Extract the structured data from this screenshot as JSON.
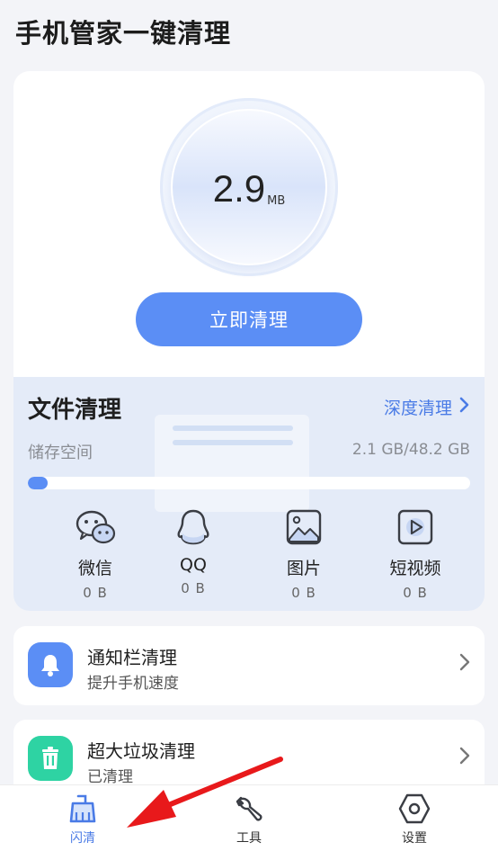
{
  "app": {
    "title": "手机管家一键清理"
  },
  "hero": {
    "size_value": "2.9",
    "size_unit": "MB",
    "clean_button": "立即清理"
  },
  "file_clean": {
    "title": "文件清理",
    "deep_clean": "深度清理",
    "storage_label": "储存空间",
    "storage_value": "2.1 GB/48.2 GB",
    "storage_fraction": 0.044,
    "categories": [
      {
        "name": "微信",
        "value": "0 B",
        "icon": "wechat-icon"
      },
      {
        "name": "QQ",
        "value": "0 B",
        "icon": "qq-icon"
      },
      {
        "name": "图片",
        "value": "0 B",
        "icon": "image-icon"
      },
      {
        "name": "短视频",
        "value": "0 B",
        "icon": "video-icon"
      }
    ]
  },
  "list": [
    {
      "title": "通知栏清理",
      "subtitle": "提升手机速度",
      "icon": "bell-icon",
      "color": "#5b8ef5"
    },
    {
      "title": "超大垃圾清理",
      "subtitle": "已清理",
      "icon": "trash-icon",
      "color": "#2ed3a3"
    }
  ],
  "nav": [
    {
      "label": "闪清",
      "icon": "broom-icon",
      "active": true
    },
    {
      "label": "工具",
      "icon": "wrench-icon",
      "active": false
    },
    {
      "label": "设置",
      "icon": "settings-icon",
      "active": false
    }
  ],
  "colors": {
    "accent": "#5b8ef5",
    "link": "#4a7be6",
    "annotation_arrow": "#e8191b"
  }
}
